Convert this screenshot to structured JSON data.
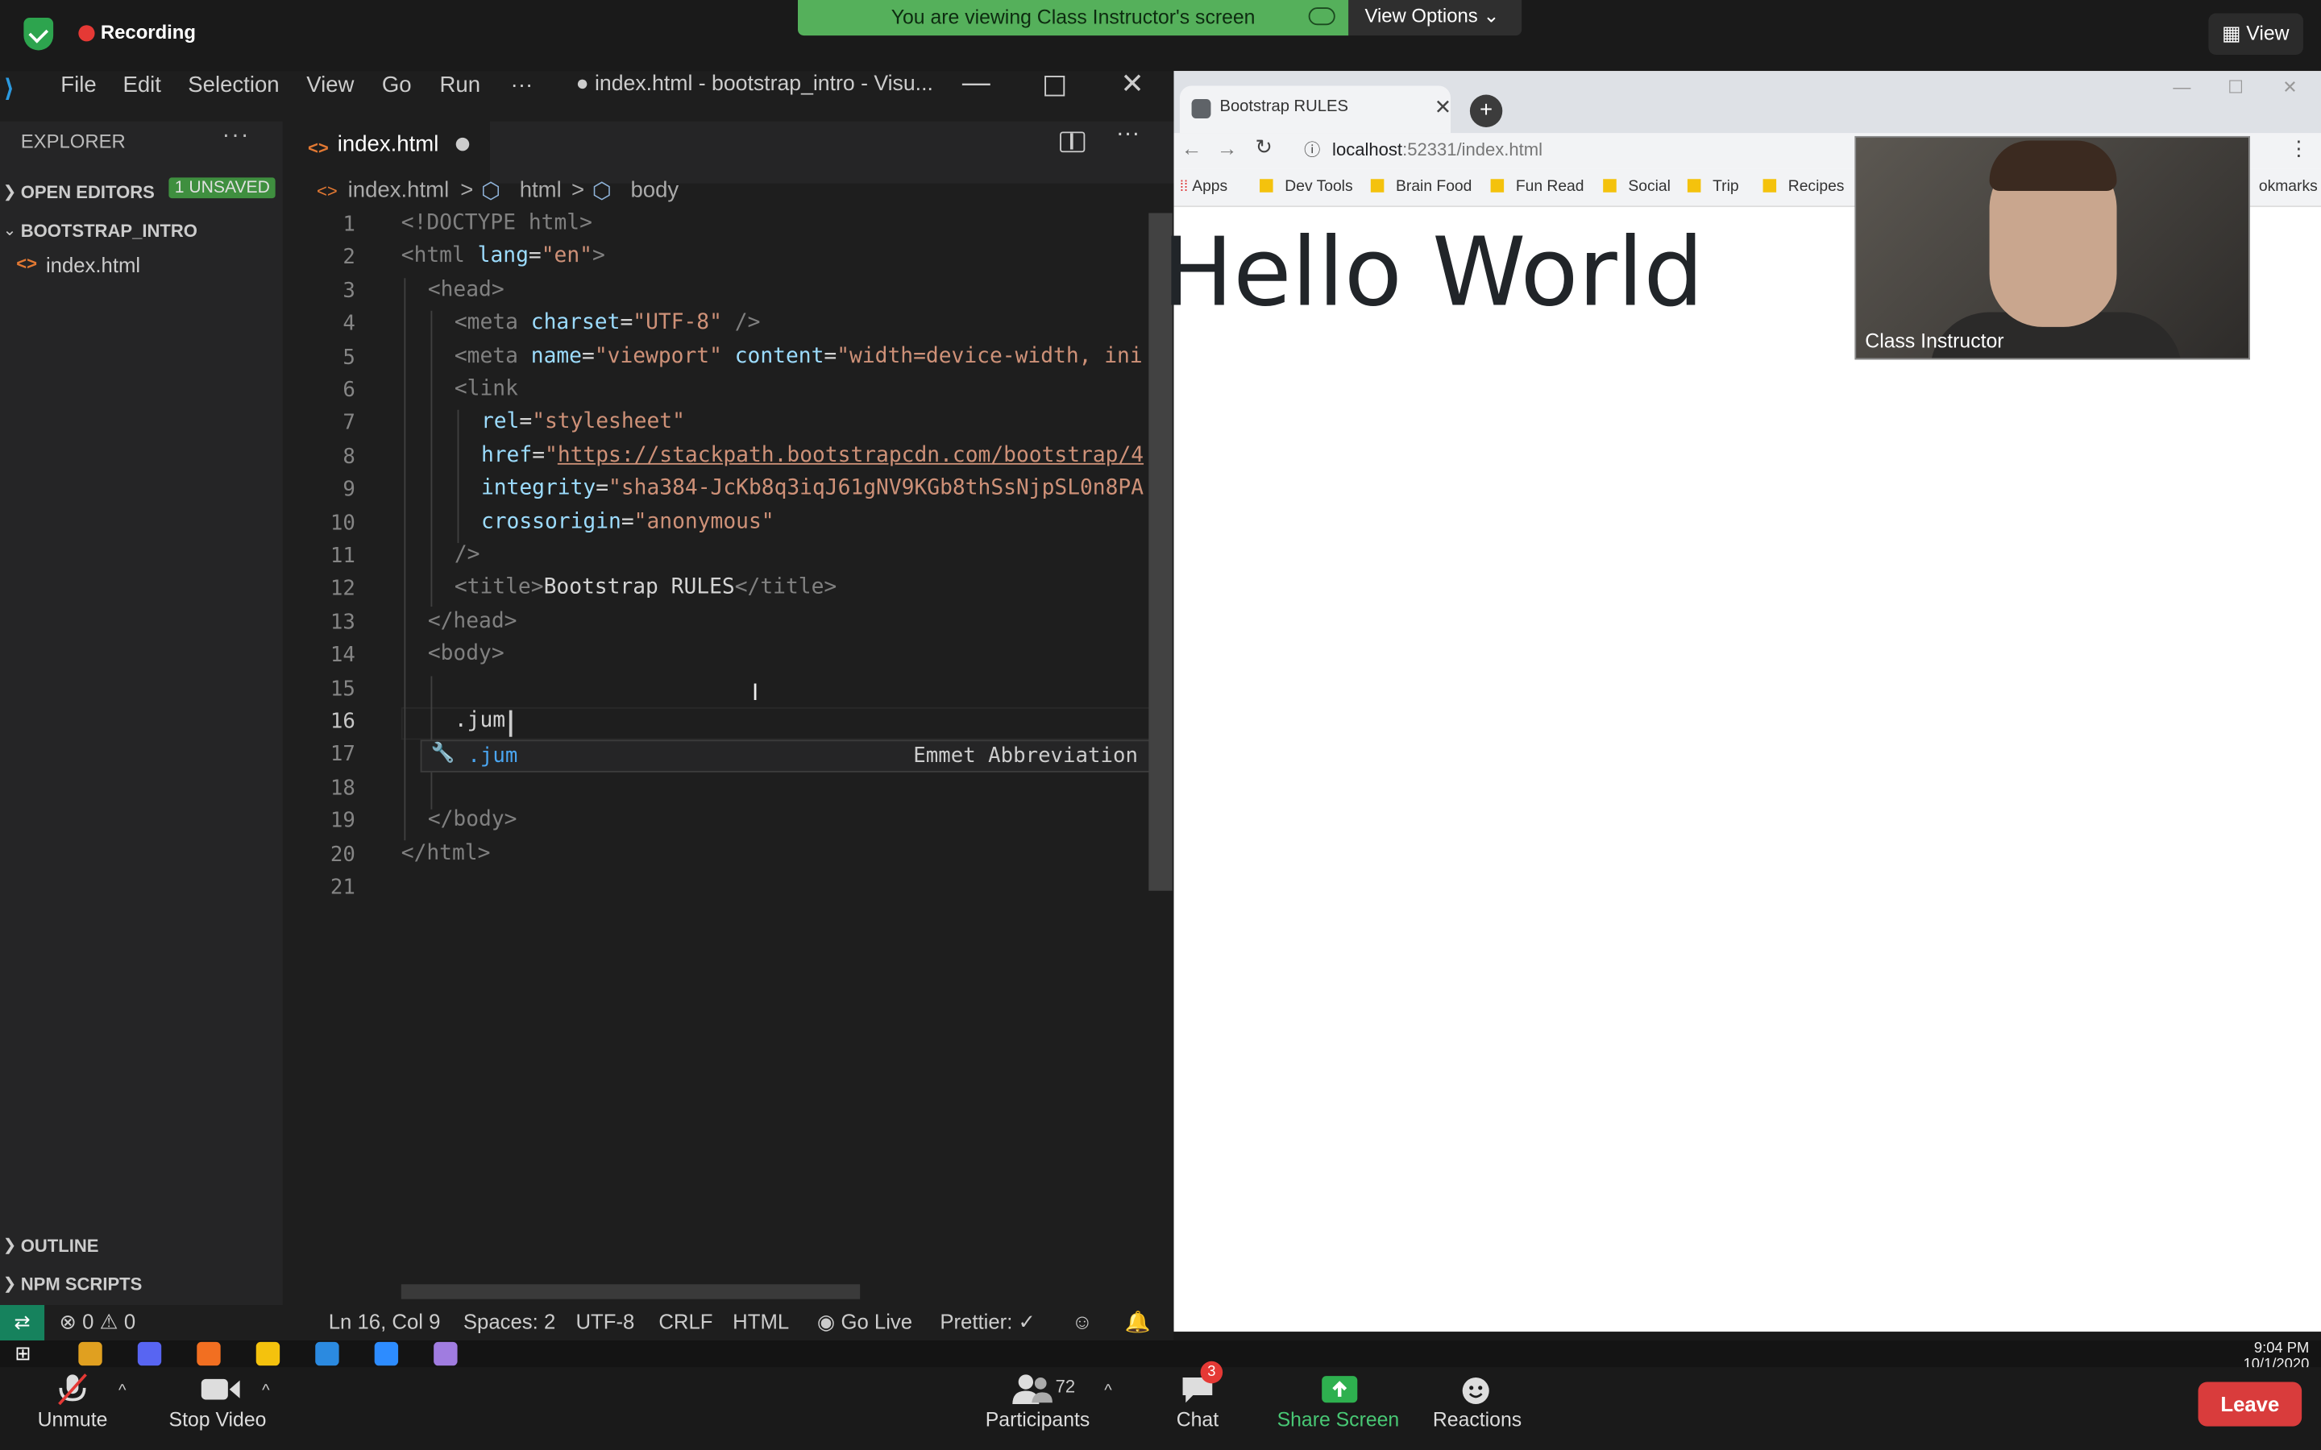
{
  "zoom": {
    "recording_label": "Recording",
    "banner_text": "You are viewing Class Instructor's screen",
    "view_options_label": "View Options ⌄",
    "view_button_label": "View",
    "controls": {
      "unmute": "Unmute",
      "stop_video": "Stop Video",
      "participants": "Participants",
      "participants_count": "72",
      "chat": "Chat",
      "chat_badge": "3",
      "share_screen": "Share Screen",
      "reactions": "Reactions",
      "leave": "Leave"
    },
    "video_name": "Class Instructor"
  },
  "vscode": {
    "menu": [
      "File",
      "Edit",
      "Selection",
      "View",
      "Go",
      "Run",
      "···"
    ],
    "window_title": "● index.html - bootstrap_intro - Visu...",
    "explorer_title": "EXPLORER",
    "explorer_more": "···",
    "open_editors": "OPEN EDITORS",
    "unsaved_badge": "1 UNSAVED",
    "project": "BOOTSTRAP_INTRO",
    "file": "index.html",
    "tab": "index.html",
    "breadcrumb": [
      "index.html",
      ">",
      "html",
      ">",
      "body"
    ],
    "line_numbers": [
      "1",
      "2",
      "3",
      "4",
      "5",
      "6",
      "7",
      "8",
      "9",
      "10",
      "11",
      "12",
      "13",
      "14",
      "15",
      "16",
      "17",
      "18",
      "19",
      "20",
      "21"
    ],
    "code": {
      "l1": "<!DOCTYPE html>",
      "l2a": "<html ",
      "l2b": "lang",
      "l2c": "=",
      "l2d": "\"en\"",
      "l2e": ">",
      "l3": "<head>",
      "l4a": "<meta ",
      "l4b": "charset",
      "l4c": "=",
      "l4d": "\"UTF-8\"",
      "l4e": " />",
      "l5a": "<meta ",
      "l5b": "name",
      "l5c": "=",
      "l5d": "\"viewport\"",
      "l5e": " content",
      "l5f": "=",
      "l5g": "\"width=device-width, ini",
      "l6": "<link",
      "l7a": "rel",
      "l7b": "=",
      "l7c": "\"stylesheet\"",
      "l8a": "href",
      "l8b": "=",
      "l8c": "\"",
      "l8d": "https://stackpath.bootstrapcdn.com/bootstrap/4",
      "l9a": "integrity",
      "l9b": "=",
      "l9c": "\"sha384-JcKb8q3iqJ61gNV9KGb8thSsNjpSL0n8PA",
      "l10a": "crossorigin",
      "l10b": "=",
      "l10c": "\"anonymous\"",
      "l11": "/>",
      "l12a": "<title>",
      "l12b": "Bootstrap RULES",
      "l12c": "</title>",
      "l13": "</head>",
      "l14": "<body>",
      "l16": ".jum",
      "l19": "</body>",
      "l20": "</html>"
    },
    "suggestion": {
      "label": ".jum",
      "kind": "Emmet Abbreviation"
    },
    "outline": "OUTLINE",
    "npm_scripts": "NPM SCRIPTS",
    "status": {
      "errors": "0",
      "warnings": "0",
      "position": "Ln 16, Col 9",
      "spaces": "Spaces: 2",
      "encoding": "UTF-8",
      "eol": "CRLF",
      "language": "HTML",
      "go_live": "Go Live",
      "prettier": "Prettier: ✓"
    }
  },
  "chrome": {
    "tab_title": "Bootstrap RULES",
    "url_host": "localhost",
    "url_rest": ":52331/index.html",
    "bookmarks": [
      "Apps",
      "Dev Tools",
      "Brain Food",
      "Fun Read",
      "Social",
      "Trip",
      "Recipes"
    ],
    "bookmarks_other": "okmarks",
    "heading": "Hello World"
  },
  "taskbar": {
    "time": "9:04 PM",
    "date": "10/1/2020"
  }
}
